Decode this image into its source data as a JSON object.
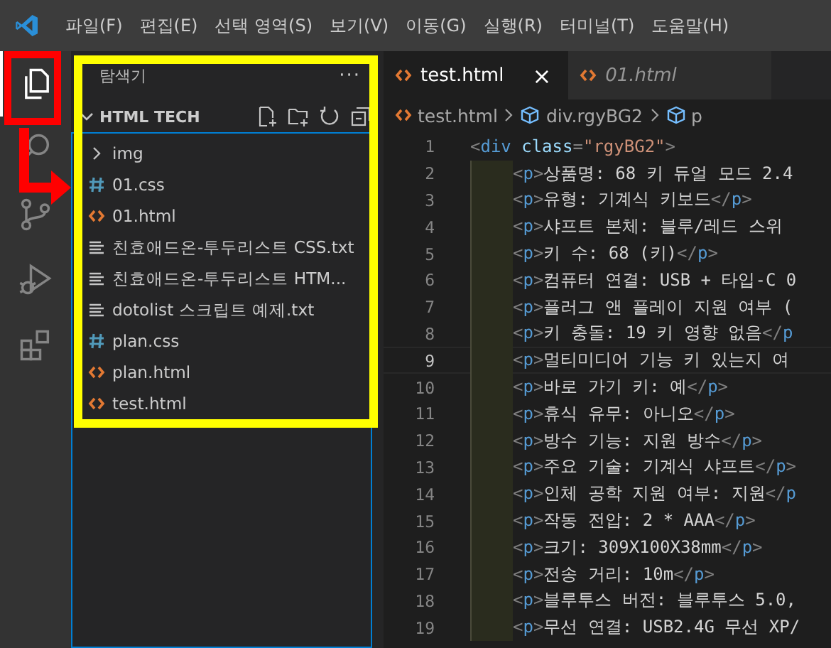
{
  "menu_bar": {
    "items": [
      "파일(F)",
      "편집(E)",
      "선택 영역(S)",
      "보기(V)",
      "이동(G)",
      "실행(R)",
      "터미널(T)",
      "도움말(H)"
    ]
  },
  "activity_bar": [
    {
      "kind": "explorer",
      "selected": true
    },
    {
      "kind": "search",
      "selected": false
    },
    {
      "kind": "source-control",
      "selected": false
    },
    {
      "kind": "run-debug",
      "selected": false
    },
    {
      "kind": "extensions",
      "selected": false
    }
  ],
  "sidebar": {
    "title": "탐색기",
    "more": "···",
    "section": {
      "label": "HTML TECH",
      "expanded": true
    },
    "items": [
      {
        "kind": "folder",
        "label": "img",
        "expanded": false
      },
      {
        "kind": "css",
        "label": "01.css"
      },
      {
        "kind": "html",
        "label": "01.html"
      },
      {
        "kind": "txt",
        "label": "친효애드온-투두리스트 CSS.txt"
      },
      {
        "kind": "txt",
        "label": "친효애드온-투두리스트 HTM..."
      },
      {
        "kind": "txt",
        "label": "dotolist 스크립트 예제.txt"
      },
      {
        "kind": "css",
        "label": "plan.css"
      },
      {
        "kind": "html",
        "label": "plan.html"
      },
      {
        "kind": "html",
        "label": "test.html"
      }
    ]
  },
  "tabs": [
    {
      "label": "test.html",
      "selected": true,
      "preview": false,
      "close": "×"
    },
    {
      "label": "01.html",
      "selected": false,
      "preview": true
    }
  ],
  "breadcrumb": [
    {
      "kind": "html",
      "label": "test.html"
    },
    {
      "kind": "element",
      "label": "div.rgyBG2"
    },
    {
      "kind": "element",
      "label": "p"
    }
  ],
  "editor": {
    "lines": [
      {
        "number": "1",
        "current": false,
        "indent": false,
        "tokens": [
          {
            "kind": "punct",
            "text": "<"
          },
          {
            "kind": "tag",
            "text": "div"
          },
          {
            "kind": "attr",
            "text": "class"
          },
          {
            "kind": "punct",
            "text": "="
          },
          {
            "kind": "string",
            "text": "\"rgyBG2\""
          },
          {
            "kind": "punct",
            "text": ">"
          }
        ]
      },
      {
        "number": "2",
        "current": false,
        "indent": true,
        "tokens": [
          {
            "kind": "punct",
            "text": "<"
          },
          {
            "kind": "tag",
            "text": "p"
          },
          {
            "kind": "punct",
            "text": ">"
          },
          {
            "kind": "plain",
            "text": "상품명: 68 키 듀얼 모드 2.4"
          }
        ]
      },
      {
        "number": "3",
        "current": false,
        "indent": true,
        "tokens": [
          {
            "kind": "punct",
            "text": "<"
          },
          {
            "kind": "tag",
            "text": "p"
          },
          {
            "kind": "punct",
            "text": ">"
          },
          {
            "kind": "plain",
            "text": "유형: 기계식 키보드"
          },
          {
            "kind": "punct",
            "text": "</"
          },
          {
            "kind": "tag",
            "text": "p"
          },
          {
            "kind": "punct",
            "text": ">"
          }
        ]
      },
      {
        "number": "4",
        "current": false,
        "indent": true,
        "tokens": [
          {
            "kind": "punct",
            "text": "<"
          },
          {
            "kind": "tag",
            "text": "p"
          },
          {
            "kind": "punct",
            "text": ">"
          },
          {
            "kind": "plain",
            "text": "샤프트 본체: 블루/레드 스위"
          }
        ]
      },
      {
        "number": "5",
        "current": false,
        "indent": true,
        "tokens": [
          {
            "kind": "punct",
            "text": "<"
          },
          {
            "kind": "tag",
            "text": "p"
          },
          {
            "kind": "punct",
            "text": ">"
          },
          {
            "kind": "plain",
            "text": "키 수: 68 (키)"
          },
          {
            "kind": "punct",
            "text": "</"
          },
          {
            "kind": "tag",
            "text": "p"
          },
          {
            "kind": "punct",
            "text": ">"
          }
        ]
      },
      {
        "number": "6",
        "current": false,
        "indent": true,
        "tokens": [
          {
            "kind": "punct",
            "text": "<"
          },
          {
            "kind": "tag",
            "text": "p"
          },
          {
            "kind": "punct",
            "text": ">"
          },
          {
            "kind": "plain",
            "text": "컴퓨터 연결: USB + 타입-C 0"
          }
        ]
      },
      {
        "number": "7",
        "current": false,
        "indent": true,
        "tokens": [
          {
            "kind": "punct",
            "text": "<"
          },
          {
            "kind": "tag",
            "text": "p"
          },
          {
            "kind": "punct",
            "text": ">"
          },
          {
            "kind": "plain",
            "text": "플러그 앤 플레이 지원 여부 ("
          }
        ]
      },
      {
        "number": "8",
        "current": false,
        "indent": true,
        "tokens": [
          {
            "kind": "punct",
            "text": "<"
          },
          {
            "kind": "tag",
            "text": "p"
          },
          {
            "kind": "punct",
            "text": ">"
          },
          {
            "kind": "plain",
            "text": "키 충돌: 19 키 영향 없음"
          },
          {
            "kind": "punct",
            "text": "</"
          },
          {
            "kind": "tag",
            "text": "p"
          }
        ]
      },
      {
        "number": "9",
        "current": true,
        "indent": true,
        "tokens": [
          {
            "kind": "punct",
            "text": "<"
          },
          {
            "kind": "tag",
            "text": "p"
          },
          {
            "kind": "punct",
            "text": ">"
          },
          {
            "kind": "plain",
            "text": "멀티미디어 기능 키 있는지 여"
          }
        ]
      },
      {
        "number": "10",
        "current": false,
        "indent": true,
        "tokens": [
          {
            "kind": "punct",
            "text": "<"
          },
          {
            "kind": "tag",
            "text": "p"
          },
          {
            "kind": "punct",
            "text": ">"
          },
          {
            "kind": "plain",
            "text": "바로 가기 키: 예"
          },
          {
            "kind": "punct",
            "text": "</"
          },
          {
            "kind": "tag",
            "text": "p"
          },
          {
            "kind": "punct",
            "text": ">"
          }
        ]
      },
      {
        "number": "11",
        "current": false,
        "indent": true,
        "tokens": [
          {
            "kind": "punct",
            "text": "<"
          },
          {
            "kind": "tag",
            "text": "p"
          },
          {
            "kind": "punct",
            "text": ">"
          },
          {
            "kind": "plain",
            "text": "휴식 유무: 아니오"
          },
          {
            "kind": "punct",
            "text": "</"
          },
          {
            "kind": "tag",
            "text": "p"
          },
          {
            "kind": "punct",
            "text": ">"
          }
        ]
      },
      {
        "number": "12",
        "current": false,
        "indent": true,
        "tokens": [
          {
            "kind": "punct",
            "text": "<"
          },
          {
            "kind": "tag",
            "text": "p"
          },
          {
            "kind": "punct",
            "text": ">"
          },
          {
            "kind": "plain",
            "text": "방수 기능: 지원 방수"
          },
          {
            "kind": "punct",
            "text": "</"
          },
          {
            "kind": "tag",
            "text": "p"
          },
          {
            "kind": "punct",
            "text": ">"
          }
        ]
      },
      {
        "number": "13",
        "current": false,
        "indent": true,
        "tokens": [
          {
            "kind": "punct",
            "text": "<"
          },
          {
            "kind": "tag",
            "text": "p"
          },
          {
            "kind": "punct",
            "text": ">"
          },
          {
            "kind": "plain",
            "text": "주요 기술: 기계식 샤프트"
          },
          {
            "kind": "punct",
            "text": "</"
          },
          {
            "kind": "tag",
            "text": "p"
          },
          {
            "kind": "punct",
            "text": ">"
          }
        ]
      },
      {
        "number": "14",
        "current": false,
        "indent": true,
        "tokens": [
          {
            "kind": "punct",
            "text": "<"
          },
          {
            "kind": "tag",
            "text": "p"
          },
          {
            "kind": "punct",
            "text": ">"
          },
          {
            "kind": "plain",
            "text": "인체 공학 지원 여부: 지원"
          },
          {
            "kind": "punct",
            "text": "</"
          },
          {
            "kind": "tag",
            "text": "p"
          }
        ]
      },
      {
        "number": "15",
        "current": false,
        "indent": true,
        "tokens": [
          {
            "kind": "punct",
            "text": "<"
          },
          {
            "kind": "tag",
            "text": "p"
          },
          {
            "kind": "punct",
            "text": ">"
          },
          {
            "kind": "plain",
            "text": "작동 전압: 2 * AAA"
          },
          {
            "kind": "punct",
            "text": "</"
          },
          {
            "kind": "tag",
            "text": "p"
          },
          {
            "kind": "punct",
            "text": ">"
          }
        ]
      },
      {
        "number": "16",
        "current": false,
        "indent": true,
        "tokens": [
          {
            "kind": "punct",
            "text": "<"
          },
          {
            "kind": "tag",
            "text": "p"
          },
          {
            "kind": "punct",
            "text": ">"
          },
          {
            "kind": "plain",
            "text": "크기: 309X100X38mm"
          },
          {
            "kind": "punct",
            "text": "</"
          },
          {
            "kind": "tag",
            "text": "p"
          },
          {
            "kind": "punct",
            "text": ">"
          }
        ]
      },
      {
        "number": "17",
        "current": false,
        "indent": true,
        "tokens": [
          {
            "kind": "punct",
            "text": "<"
          },
          {
            "kind": "tag",
            "text": "p"
          },
          {
            "kind": "punct",
            "text": ">"
          },
          {
            "kind": "plain",
            "text": "전송 거리: 10m"
          },
          {
            "kind": "punct",
            "text": "</"
          },
          {
            "kind": "tag",
            "text": "p"
          },
          {
            "kind": "punct",
            "text": ">"
          }
        ]
      },
      {
        "number": "18",
        "current": false,
        "indent": true,
        "tokens": [
          {
            "kind": "punct",
            "text": "<"
          },
          {
            "kind": "tag",
            "text": "p"
          },
          {
            "kind": "punct",
            "text": ">"
          },
          {
            "kind": "plain",
            "text": "블루투스 버전: 블루투스 5.0,"
          }
        ]
      },
      {
        "number": "19",
        "current": false,
        "indent": true,
        "tokens": [
          {
            "kind": "punct",
            "text": "<"
          },
          {
            "kind": "tag",
            "text": "p"
          },
          {
            "kind": "punct",
            "text": ">"
          },
          {
            "kind": "plain",
            "text": "무선 연결: USB2.4G 무선 XP/"
          }
        ]
      }
    ]
  }
}
